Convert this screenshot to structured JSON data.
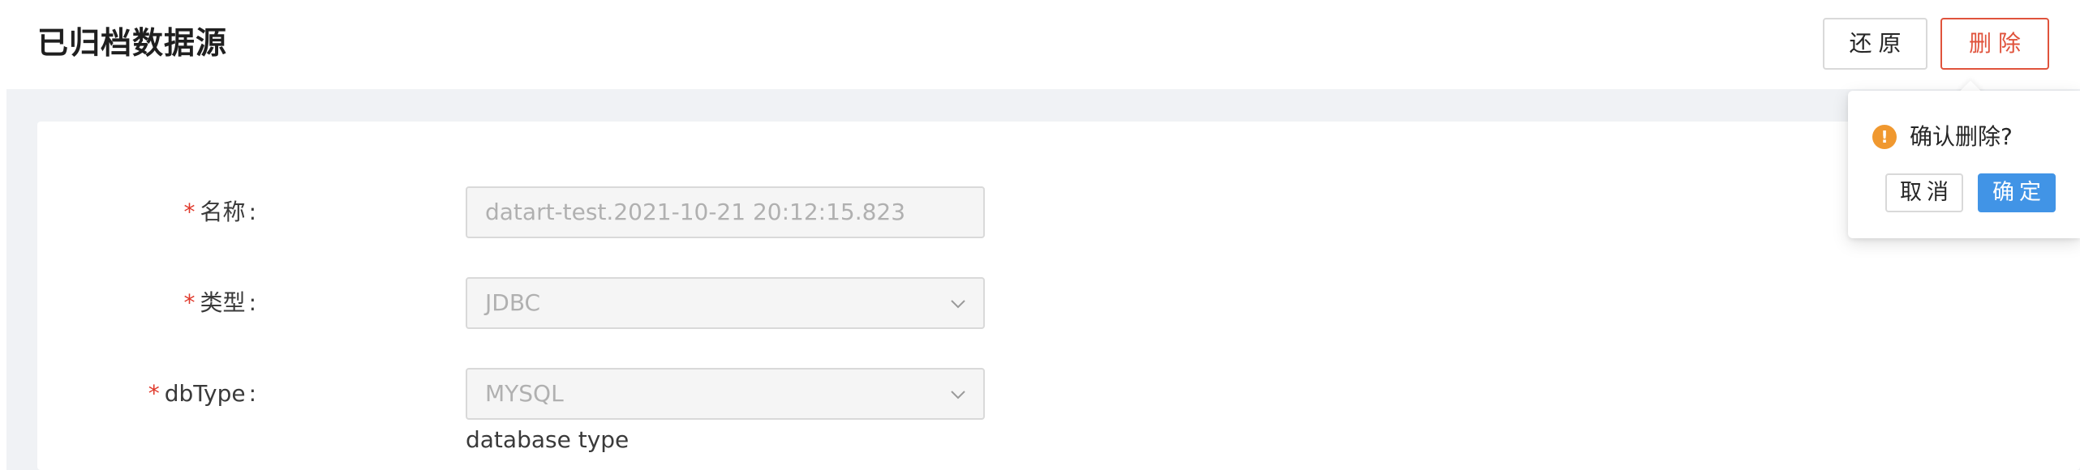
{
  "header": {
    "title": "已归档数据源",
    "restore_label": "还原",
    "delete_label": "删除"
  },
  "colors": {
    "danger": "#e0533c",
    "primary": "#4194e6",
    "warning": "#f0982f",
    "required": "#e0392b"
  },
  "form": {
    "fields": [
      {
        "label": "名称",
        "value": "datart-test.2021-10-21 20:12:15.823",
        "type": "text-input",
        "disabled": true
      },
      {
        "label": "类型",
        "value": "JDBC",
        "type": "select",
        "disabled": true,
        "icon": "chevron-down-icon"
      },
      {
        "label": "dbType",
        "value": "MYSQL",
        "type": "select",
        "disabled": true,
        "icon": "chevron-down-icon",
        "help": "database type"
      }
    ],
    "required_mark": "*",
    "label_suffix": ":"
  },
  "popconfirm": {
    "icon": "exclamation-circle-icon",
    "icon_glyph": "!",
    "message": "确认删除?",
    "cancel_label": "取消",
    "ok_label": "确定"
  }
}
